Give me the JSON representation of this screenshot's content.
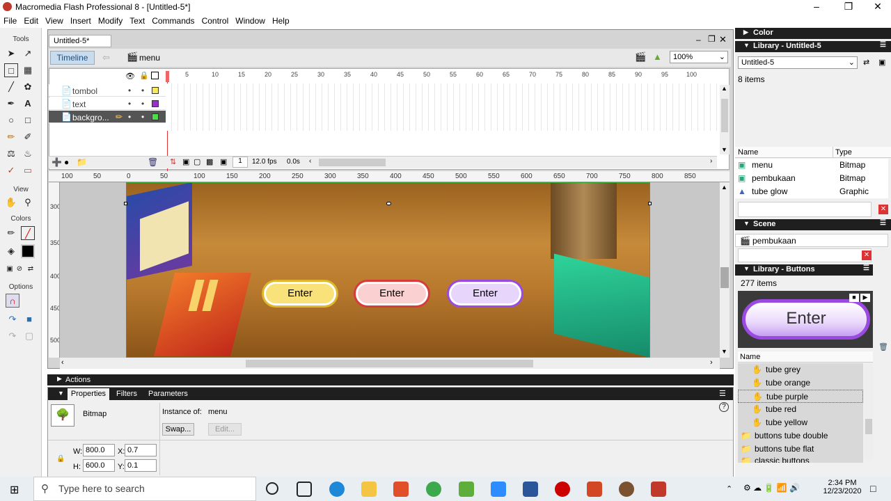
{
  "app": {
    "title": "Macromedia Flash Professional 8 - [Untitled-5*]"
  },
  "menu": [
    "File",
    "Edit",
    "View",
    "Insert",
    "Modify",
    "Text",
    "Commands",
    "Control",
    "Window",
    "Help"
  ],
  "tools": {
    "tools_label": "Tools",
    "view_label": "View",
    "colors_label": "Colors",
    "options_label": "Options"
  },
  "doc": {
    "tab": "Untitled-5*",
    "timeline_button": "Timeline",
    "scene": "menu",
    "zoom": "100%"
  },
  "timeline": {
    "frame_numbers": [
      "5",
      "10",
      "15",
      "20",
      "25",
      "30",
      "35",
      "40",
      "45",
      "50",
      "55",
      "60",
      "65",
      "70",
      "75",
      "80",
      "85",
      "90",
      "95",
      "100"
    ],
    "layers": [
      {
        "name": "tombol",
        "color": "#f7e85c"
      },
      {
        "name": "text",
        "color": "#9b2fc9"
      },
      {
        "name": "backgro...",
        "color": "#4ddc4d"
      }
    ],
    "current_frame": "1",
    "fps": "12.0 fps",
    "time": "0.0s"
  },
  "ruler_top": [
    "100",
    "50",
    "0",
    "50",
    "100",
    "150",
    "200",
    "250",
    "300",
    "350",
    "400",
    "450",
    "500",
    "550",
    "600",
    "650",
    "700",
    "750",
    "800",
    "850"
  ],
  "ruler_left": [
    "300",
    "350",
    "400",
    "450",
    "500"
  ],
  "stage_buttons": [
    {
      "label": "Enter",
      "fill": "#f9e27a",
      "ring": "#e0b72a"
    },
    {
      "label": "Enter",
      "fill": "#fbd0d0",
      "ring": "#d93a3a"
    },
    {
      "label": "Enter",
      "fill": "#e8d5fb",
      "ring": "#9a4ae0"
    }
  ],
  "actions_label": "Actions",
  "props": {
    "tabs": [
      "Properties",
      "Filters",
      "Parameters"
    ],
    "type": "Bitmap",
    "instance_label": "Instance of:",
    "instance": "menu",
    "swap": "Swap...",
    "edit": "Edit...",
    "w_label": "W:",
    "w": "800.0",
    "h_label": "H:",
    "h": "600.0",
    "x_label": "X:",
    "x": "0.7",
    "y_label": "Y:",
    "y": "0.1"
  },
  "right": {
    "color_panel": "Color",
    "library_panel": "Library - Untitled-5",
    "library_select": "Untitled-5",
    "items_count": "8 items",
    "col_name": "Name",
    "col_type": "Type",
    "library_items": [
      {
        "name": "menu",
        "type": "Bitmap"
      },
      {
        "name": "pembukaan",
        "type": "Bitmap"
      },
      {
        "name": "tube glow",
        "type": "Graphic"
      }
    ],
    "scene_panel": "Scene",
    "scene_item": "pembukaan",
    "buttons_panel": "Library - Buttons",
    "buttons_count": "277 items",
    "preview_label": "Enter",
    "buttons_list": [
      "tube grey",
      "tube orange",
      "tube purple",
      "tube red",
      "tube yellow",
      "buttons tube double",
      "buttons tube flat",
      "classic buttons"
    ]
  },
  "taskbar": {
    "search": "Type here to search",
    "time": "2:34 PM",
    "date": "12/23/2020"
  }
}
